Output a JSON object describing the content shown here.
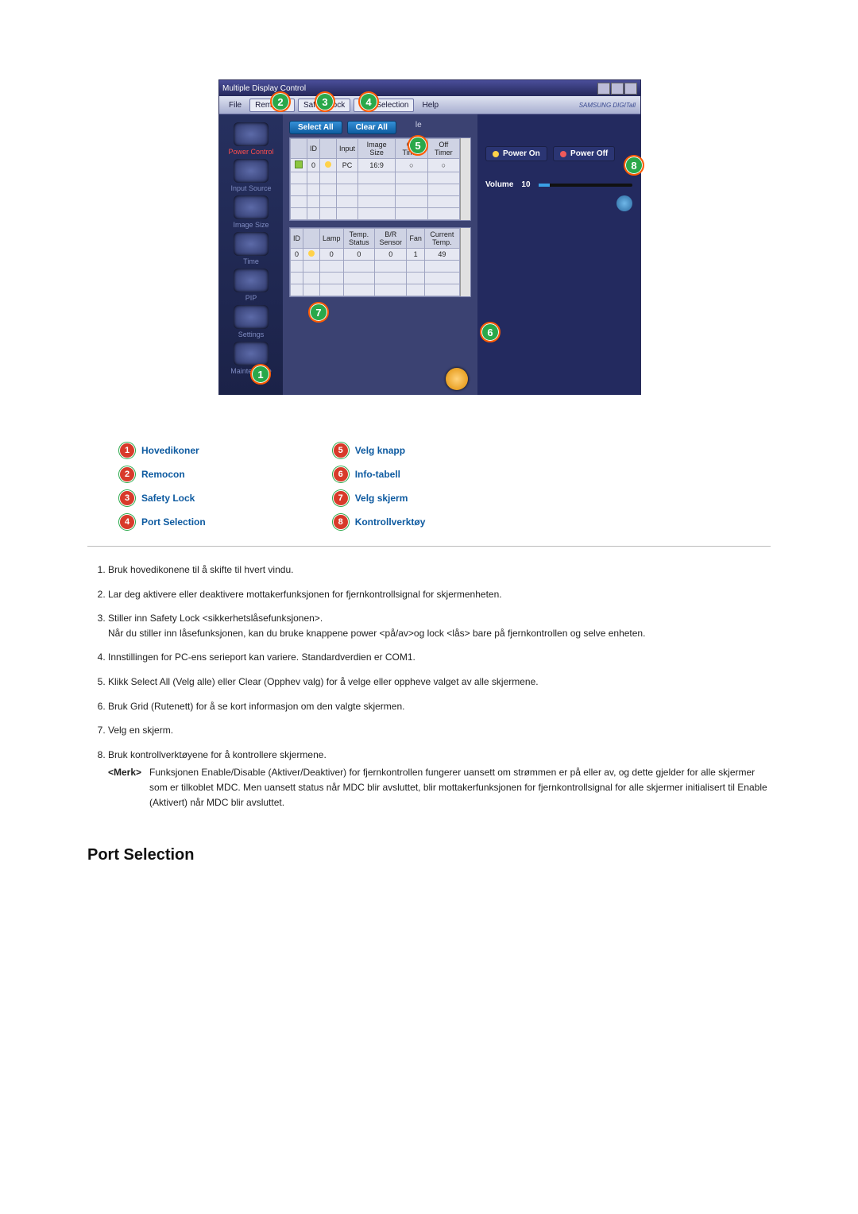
{
  "app": {
    "title": "Multiple Display Control",
    "menu": {
      "file": "File",
      "remocon": "Remocon",
      "safety": "Safety Lock",
      "port": "Port Selection",
      "help": "Help"
    },
    "brand": "SAMSUNG DIGITall",
    "sidebar": {
      "items": [
        {
          "label": "Power Control",
          "tone": "red"
        },
        {
          "label": "Input Source",
          "tone": "dim"
        },
        {
          "label": "Image Size",
          "tone": "dim"
        },
        {
          "label": "Time",
          "tone": "dim"
        },
        {
          "label": "PIP",
          "tone": "dim"
        },
        {
          "label": "Settings",
          "tone": "dim"
        },
        {
          "label": "Maintenance",
          "tone": "dim"
        }
      ]
    },
    "buttons": {
      "select_all": "Select All",
      "clear_all": "Clear All",
      "info_suffix": "le"
    },
    "main_grid": {
      "headers": [
        "",
        "ID",
        "",
        "Input",
        "Image Size",
        "On Timer",
        "Off Timer"
      ],
      "rows": [
        {
          "id": "0",
          "input": "PC",
          "size": "16:9"
        }
      ]
    },
    "status_grid": {
      "headers": [
        "ID",
        "",
        "Lamp",
        "Temp. Status",
        "B/R Sensor",
        "Fan",
        "Current Temp."
      ],
      "rows": [
        {
          "id": "0",
          "lamp": "0",
          "temp": "0",
          "br": "0",
          "fan": "1",
          "ctemp": "49"
        }
      ]
    },
    "right": {
      "power_on": "Power On",
      "power_off": "Power Off",
      "volume_label": "Volume",
      "volume_value": "10"
    }
  },
  "legend": {
    "1": "Hovedikoner",
    "2": "Remocon",
    "3": "Safety Lock",
    "4": "Port Selection",
    "5": "Velg knapp",
    "6": "Info-tabell",
    "7": "Velg skjerm",
    "8": "Kontrollverktøy"
  },
  "doc": {
    "li1": "Bruk hovedikonene til å skifte til hvert vindu.",
    "li2": "Lar deg aktivere eller deaktivere mottakerfunksjonen for fjernkontrollsignal for skjermenheten.",
    "li3a": "Stiller inn Safety Lock <sikkerhetslåsefunksjonen>.",
    "li3b": "Når du stiller inn låsefunksjonen, kan du bruke knappene power <på/av>og lock <lås> bare på fjernkontrollen og selve enheten.",
    "li4": "Innstillingen for PC-ens serieport kan variere. Standardverdien er COM1.",
    "li5": "Klikk Select All (Velg alle) eller Clear (Opphev valg) for å velge eller oppheve valget av alle skjermene.",
    "li6": "Bruk Grid (Rutenett) for å se kort informasjon om den valgte skjermen.",
    "li7": "Velg en skjerm.",
    "li8": "Bruk kontrollverktøyene for å kontrollere skjermene.",
    "note_label": "<Merk>",
    "note_body": "Funksjonen Enable/Disable (Aktiver/Deaktiver) for fjernkontrollen fungerer uansett om strømmen er på eller av, og dette gjelder for alle skjermer som er tilkoblet MDC. Men uansett status når MDC blir avsluttet, blir mottakerfunksjonen for fjernkontrollsignal for alle skjermer initialisert til Enable (Aktivert) når MDC blir avsluttet."
  },
  "section_heading": "Port Selection"
}
